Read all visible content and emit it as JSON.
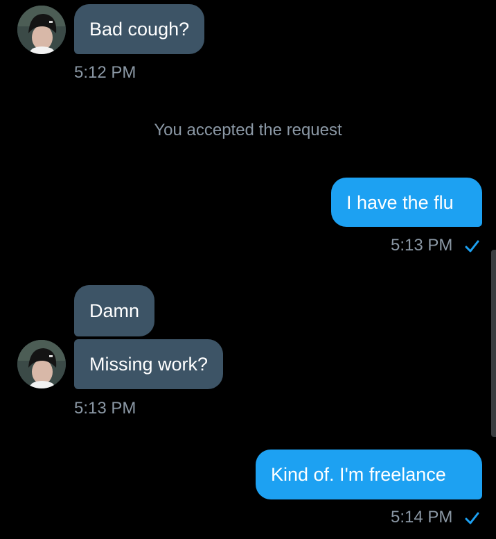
{
  "conversation": {
    "messages": [
      {
        "text": "Bad cough?"
      },
      {
        "text": "I have the flu"
      },
      {
        "text": "Damn"
      },
      {
        "text": "Missing work?"
      },
      {
        "text": "Kind of. I'm freelance"
      }
    ],
    "timestamps": {
      "t1": "5:12 PM",
      "t2": "5:13 PM",
      "t3": "5:13 PM",
      "t4": "5:14 PM"
    },
    "system_notice": "You accepted the request"
  },
  "colors": {
    "background": "#000000",
    "incoming_bubble": "#3d5466",
    "outgoing_bubble": "#1da1f2",
    "timestamp_text": "#8b98a5",
    "read_check": "#1da1f2"
  },
  "icons": {
    "avatar": "user-avatar-icon",
    "read_receipt": "checkmark-icon"
  }
}
